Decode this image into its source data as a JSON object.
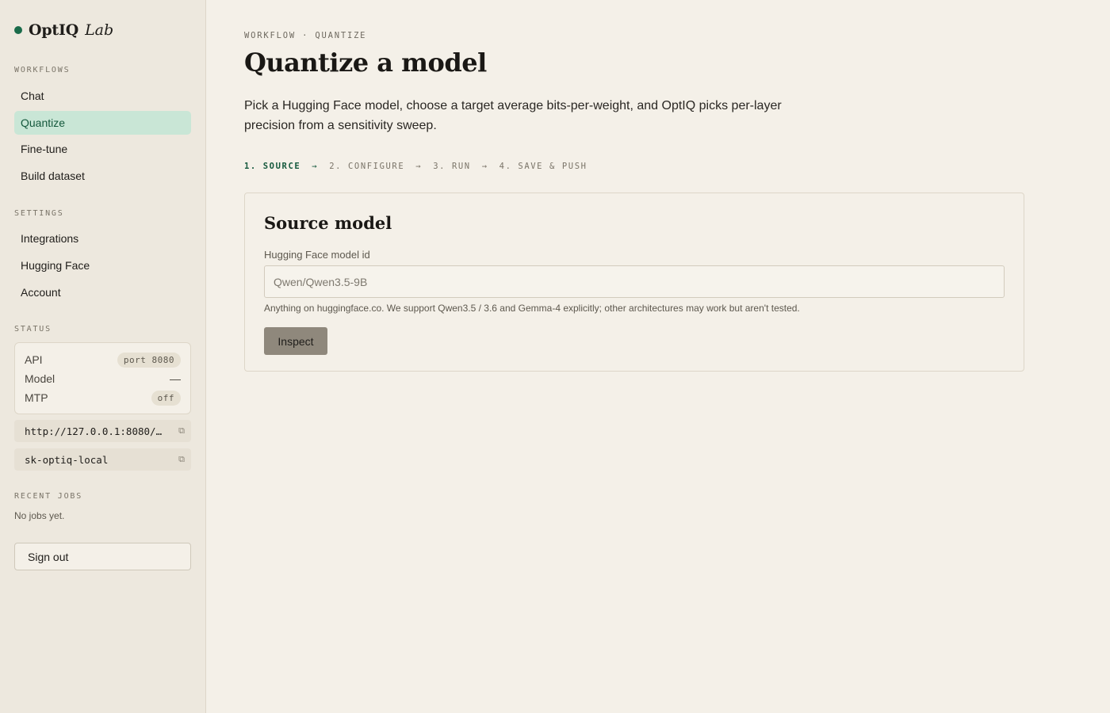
{
  "brand": {
    "name": "OptIQ",
    "sub": "Lab",
    "accent": "#1a6b4a"
  },
  "sidebar": {
    "workflows_label": "WORKFLOWS",
    "workflows": [
      {
        "label": "Chat",
        "active": false
      },
      {
        "label": "Quantize",
        "active": true
      },
      {
        "label": "Fine-tune",
        "active": false
      },
      {
        "label": "Build dataset",
        "active": false
      }
    ],
    "settings_label": "SETTINGS",
    "settings": [
      {
        "label": "Integrations"
      },
      {
        "label": "Hugging Face"
      },
      {
        "label": "Account"
      }
    ],
    "status_label": "STATUS",
    "status": {
      "api_label": "API",
      "api_value": "port 8080",
      "model_label": "Model",
      "model_value": "—",
      "mtp_label": "MTP",
      "mtp_value": "off"
    },
    "endpoint": "http://127.0.0.1:8080/…",
    "api_key": "sk-optiq-local",
    "copy_icon": "⧉",
    "recent_jobs_label": "RECENT JOBS",
    "recent_jobs_empty": "No jobs yet.",
    "sign_out": "Sign out"
  },
  "main": {
    "breadcrumb": "WORKFLOW · QUANTIZE",
    "title": "Quantize a model",
    "intro": "Pick a Hugging Face model, choose a target average bits-per-weight, and OptIQ picks per-layer precision from a sensitivity sweep.",
    "steps": [
      {
        "label": "1. SOURCE",
        "active": true
      },
      {
        "label": "2. CONFIGURE",
        "active": false
      },
      {
        "label": "3. RUN",
        "active": false
      },
      {
        "label": "4. SAVE & PUSH",
        "active": false
      }
    ],
    "step_arrow": "→",
    "card": {
      "title": "Source model",
      "field_label": "Hugging Face model id",
      "placeholder": "Qwen/Qwen3.5-9B",
      "value": "",
      "help": "Anything on huggingface.co. We support Qwen3.5 / 3.6 and Gemma-4 explicitly; other architectures may work but aren't tested.",
      "button": "Inspect"
    }
  }
}
